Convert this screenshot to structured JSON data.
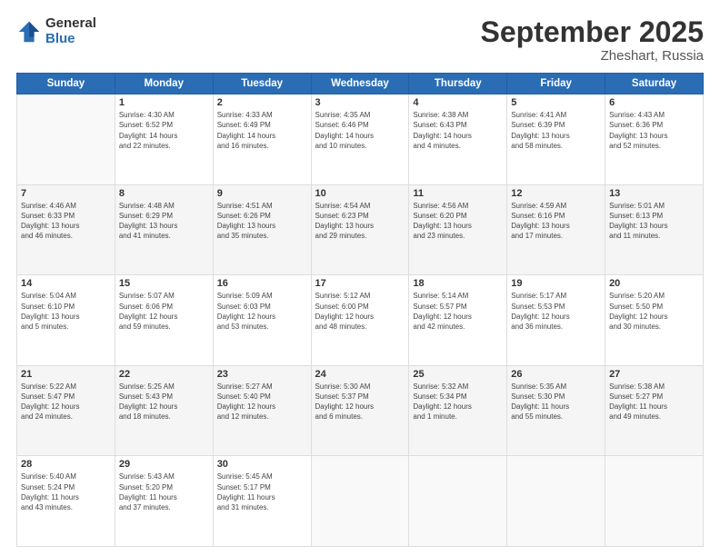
{
  "header": {
    "logo_general": "General",
    "logo_blue": "Blue",
    "title": "September 2025",
    "location": "Zheshart, Russia"
  },
  "days_of_week": [
    "Sunday",
    "Monday",
    "Tuesday",
    "Wednesday",
    "Thursday",
    "Friday",
    "Saturday"
  ],
  "weeks": [
    [
      {
        "num": "",
        "info": ""
      },
      {
        "num": "1",
        "info": "Sunrise: 4:30 AM\nSunset: 6:52 PM\nDaylight: 14 hours\nand 22 minutes."
      },
      {
        "num": "2",
        "info": "Sunrise: 4:33 AM\nSunset: 6:49 PM\nDaylight: 14 hours\nand 16 minutes."
      },
      {
        "num": "3",
        "info": "Sunrise: 4:35 AM\nSunset: 6:46 PM\nDaylight: 14 hours\nand 10 minutes."
      },
      {
        "num": "4",
        "info": "Sunrise: 4:38 AM\nSunset: 6:43 PM\nDaylight: 14 hours\nand 4 minutes."
      },
      {
        "num": "5",
        "info": "Sunrise: 4:41 AM\nSunset: 6:39 PM\nDaylight: 13 hours\nand 58 minutes."
      },
      {
        "num": "6",
        "info": "Sunrise: 4:43 AM\nSunset: 6:36 PM\nDaylight: 13 hours\nand 52 minutes."
      }
    ],
    [
      {
        "num": "7",
        "info": "Sunrise: 4:46 AM\nSunset: 6:33 PM\nDaylight: 13 hours\nand 46 minutes."
      },
      {
        "num": "8",
        "info": "Sunrise: 4:48 AM\nSunset: 6:29 PM\nDaylight: 13 hours\nand 41 minutes."
      },
      {
        "num": "9",
        "info": "Sunrise: 4:51 AM\nSunset: 6:26 PM\nDaylight: 13 hours\nand 35 minutes."
      },
      {
        "num": "10",
        "info": "Sunrise: 4:54 AM\nSunset: 6:23 PM\nDaylight: 13 hours\nand 29 minutes."
      },
      {
        "num": "11",
        "info": "Sunrise: 4:56 AM\nSunset: 6:20 PM\nDaylight: 13 hours\nand 23 minutes."
      },
      {
        "num": "12",
        "info": "Sunrise: 4:59 AM\nSunset: 6:16 PM\nDaylight: 13 hours\nand 17 minutes."
      },
      {
        "num": "13",
        "info": "Sunrise: 5:01 AM\nSunset: 6:13 PM\nDaylight: 13 hours\nand 11 minutes."
      }
    ],
    [
      {
        "num": "14",
        "info": "Sunrise: 5:04 AM\nSunset: 6:10 PM\nDaylight: 13 hours\nand 5 minutes."
      },
      {
        "num": "15",
        "info": "Sunrise: 5:07 AM\nSunset: 6:06 PM\nDaylight: 12 hours\nand 59 minutes."
      },
      {
        "num": "16",
        "info": "Sunrise: 5:09 AM\nSunset: 6:03 PM\nDaylight: 12 hours\nand 53 minutes."
      },
      {
        "num": "17",
        "info": "Sunrise: 5:12 AM\nSunset: 6:00 PM\nDaylight: 12 hours\nand 48 minutes."
      },
      {
        "num": "18",
        "info": "Sunrise: 5:14 AM\nSunset: 5:57 PM\nDaylight: 12 hours\nand 42 minutes."
      },
      {
        "num": "19",
        "info": "Sunrise: 5:17 AM\nSunset: 5:53 PM\nDaylight: 12 hours\nand 36 minutes."
      },
      {
        "num": "20",
        "info": "Sunrise: 5:20 AM\nSunset: 5:50 PM\nDaylight: 12 hours\nand 30 minutes."
      }
    ],
    [
      {
        "num": "21",
        "info": "Sunrise: 5:22 AM\nSunset: 5:47 PM\nDaylight: 12 hours\nand 24 minutes."
      },
      {
        "num": "22",
        "info": "Sunrise: 5:25 AM\nSunset: 5:43 PM\nDaylight: 12 hours\nand 18 minutes."
      },
      {
        "num": "23",
        "info": "Sunrise: 5:27 AM\nSunset: 5:40 PM\nDaylight: 12 hours\nand 12 minutes."
      },
      {
        "num": "24",
        "info": "Sunrise: 5:30 AM\nSunset: 5:37 PM\nDaylight: 12 hours\nand 6 minutes."
      },
      {
        "num": "25",
        "info": "Sunrise: 5:32 AM\nSunset: 5:34 PM\nDaylight: 12 hours\nand 1 minute."
      },
      {
        "num": "26",
        "info": "Sunrise: 5:35 AM\nSunset: 5:30 PM\nDaylight: 11 hours\nand 55 minutes."
      },
      {
        "num": "27",
        "info": "Sunrise: 5:38 AM\nSunset: 5:27 PM\nDaylight: 11 hours\nand 49 minutes."
      }
    ],
    [
      {
        "num": "28",
        "info": "Sunrise: 5:40 AM\nSunset: 5:24 PM\nDaylight: 11 hours\nand 43 minutes."
      },
      {
        "num": "29",
        "info": "Sunrise: 5:43 AM\nSunset: 5:20 PM\nDaylight: 11 hours\nand 37 minutes."
      },
      {
        "num": "30",
        "info": "Sunrise: 5:45 AM\nSunset: 5:17 PM\nDaylight: 11 hours\nand 31 minutes."
      },
      {
        "num": "",
        "info": ""
      },
      {
        "num": "",
        "info": ""
      },
      {
        "num": "",
        "info": ""
      },
      {
        "num": "",
        "info": ""
      }
    ]
  ]
}
